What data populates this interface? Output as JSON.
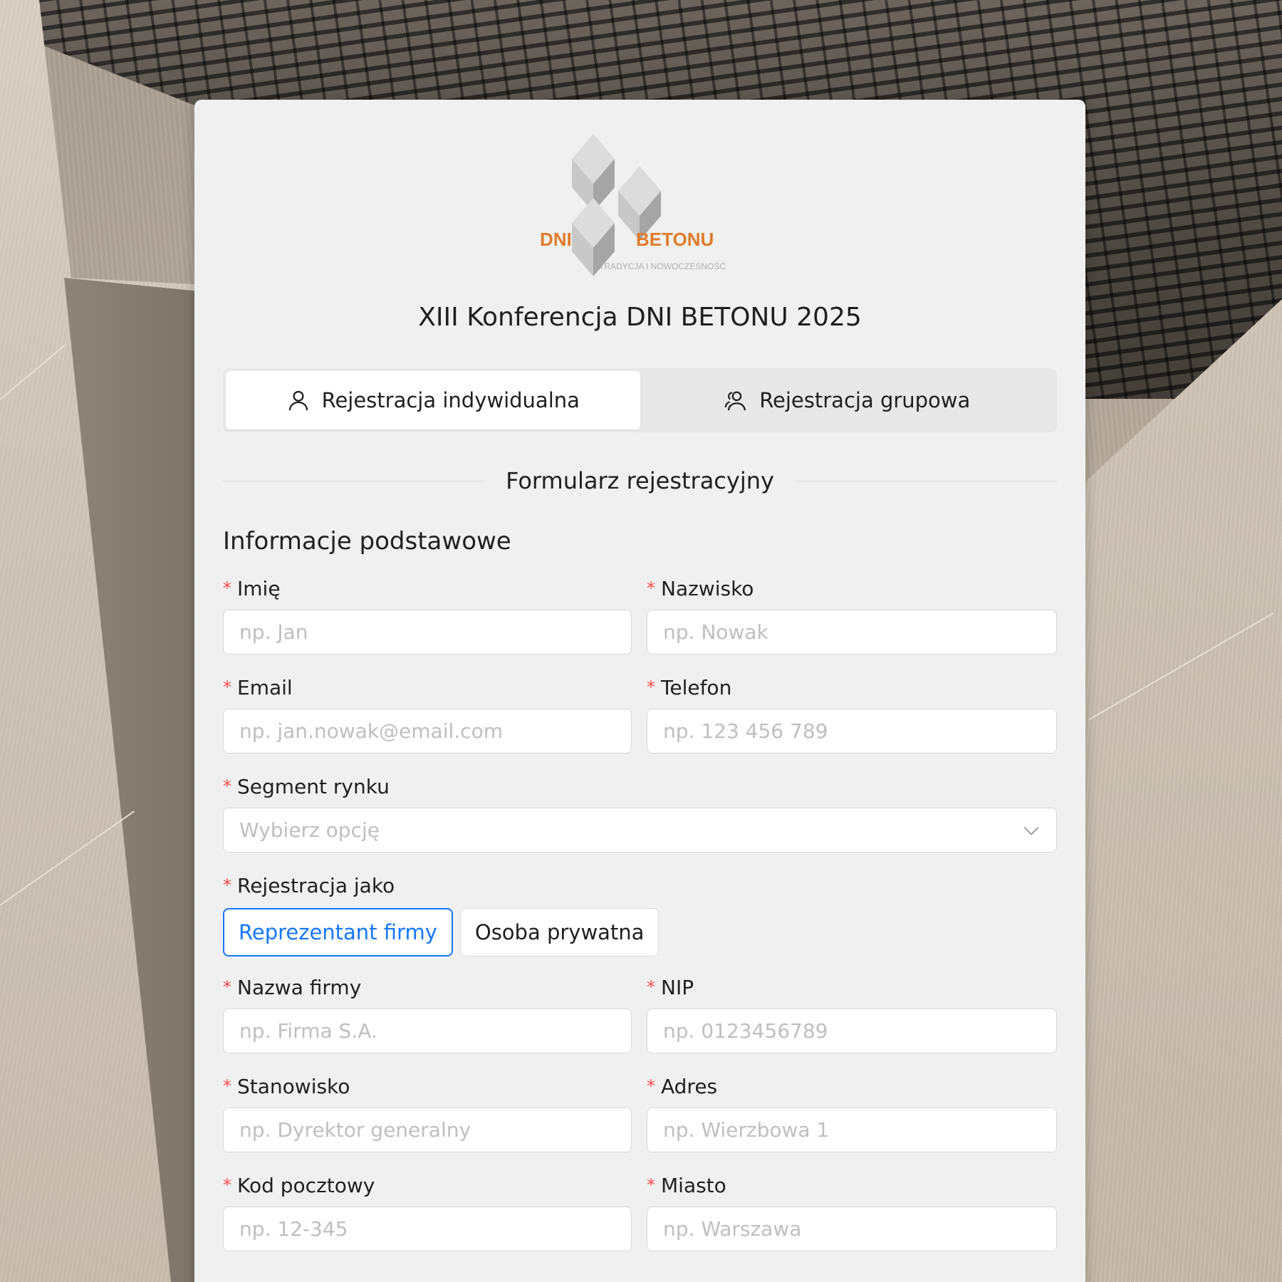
{
  "logo": {
    "left_text": "DNI",
    "right_text": "BETONU",
    "tagline": "TRADYCJA I NOWOCZESNOŚĆ",
    "accent_color": "#e07b2a"
  },
  "title": "XIII Konferencja DNI BETONU 2025",
  "tabs": [
    {
      "label": "Rejestracja indywidualna",
      "icon": "user-icon",
      "active": true
    },
    {
      "label": "Rejestracja grupowa",
      "icon": "users-icon",
      "active": false
    }
  ],
  "form_heading": "Formularz rejestracyjny",
  "section_title": "Informacje podstawowe",
  "fields": {
    "first_name": {
      "label": "Imię",
      "placeholder": "np. Jan",
      "value": ""
    },
    "last_name": {
      "label": "Nazwisko",
      "placeholder": "np. Nowak",
      "value": ""
    },
    "email": {
      "label": "Email",
      "placeholder": "np. jan.nowak@email.com",
      "value": ""
    },
    "phone": {
      "label": "Telefon",
      "placeholder": "np. 123 456 789",
      "value": ""
    },
    "segment": {
      "label": "Segment rynku",
      "placeholder": "Wybierz opcję",
      "icon": "chevron-down-icon"
    },
    "register_as": {
      "label": "Rejestracja jako",
      "options": [
        "Reprezentant firmy",
        "Osoba prywatna"
      ],
      "selected": "Reprezentant firmy"
    },
    "company": {
      "label": "Nazwa firmy",
      "placeholder": "np. Firma S.A.",
      "value": ""
    },
    "nip": {
      "label": "NIP",
      "placeholder": "np. 0123456789",
      "value": ""
    },
    "position": {
      "label": "Stanowisko",
      "placeholder": "np. Dyrektor generalny",
      "value": ""
    },
    "address": {
      "label": "Adres",
      "placeholder": "np. Wierzbowa 1",
      "value": ""
    },
    "postal_code": {
      "label": "Kod pocztowy",
      "placeholder": "np. 12-345",
      "value": ""
    },
    "city": {
      "label": "Miasto",
      "placeholder": "np. Warszawa",
      "value": ""
    }
  },
  "required_mark": "*",
  "colors": {
    "primary": "#1677ff",
    "required": "#ff4d4f",
    "card_bg": "#f0f0f0"
  }
}
